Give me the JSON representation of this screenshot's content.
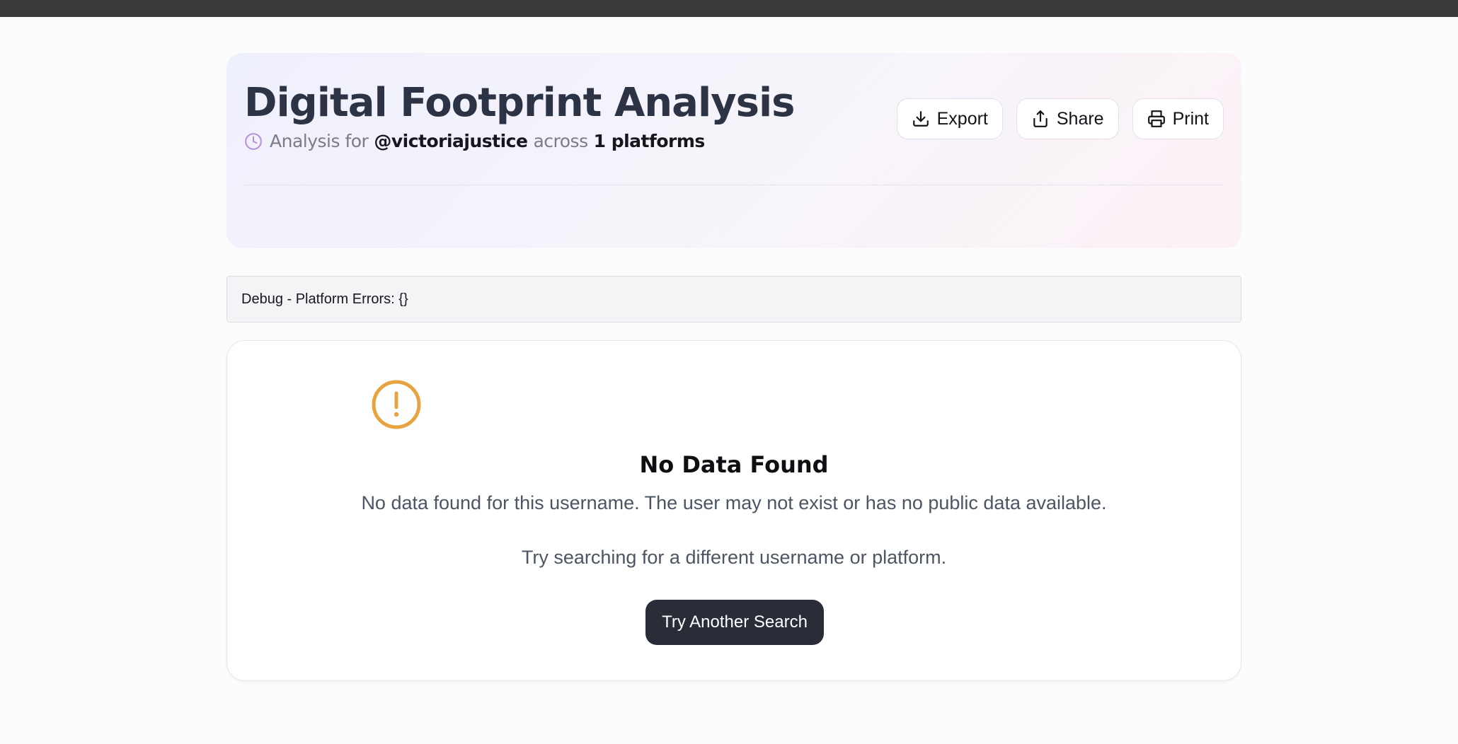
{
  "header": {
    "title": "Digital Footprint Analysis",
    "subtitle": {
      "icon": "clock-icon",
      "prefix": "Analysis for",
      "username": "@victoriajustice",
      "middle": "across",
      "platform_count": "1 platforms"
    },
    "actions": [
      {
        "label": "Export",
        "icon": "download-icon"
      },
      {
        "label": "Share",
        "icon": "share-icon"
      },
      {
        "label": "Print",
        "icon": "printer-icon"
      }
    ]
  },
  "debug": {
    "text": "Debug - Platform Errors: {}"
  },
  "empty_state": {
    "icon": "alert-circle-icon",
    "title": "No Data Found",
    "message": "No data found for this username. The user may not exist or has no public data available.",
    "hint": "Try searching for a different username or platform.",
    "button_label": "Try Another Search"
  },
  "colors": {
    "top_bar": "#3a3a3a",
    "title": "#2c3344",
    "clock_icon": "#b58be0",
    "warning_icon": "#e8a23f",
    "primary_button": "#2a2d37",
    "debug_background": "#f3f4f6"
  }
}
